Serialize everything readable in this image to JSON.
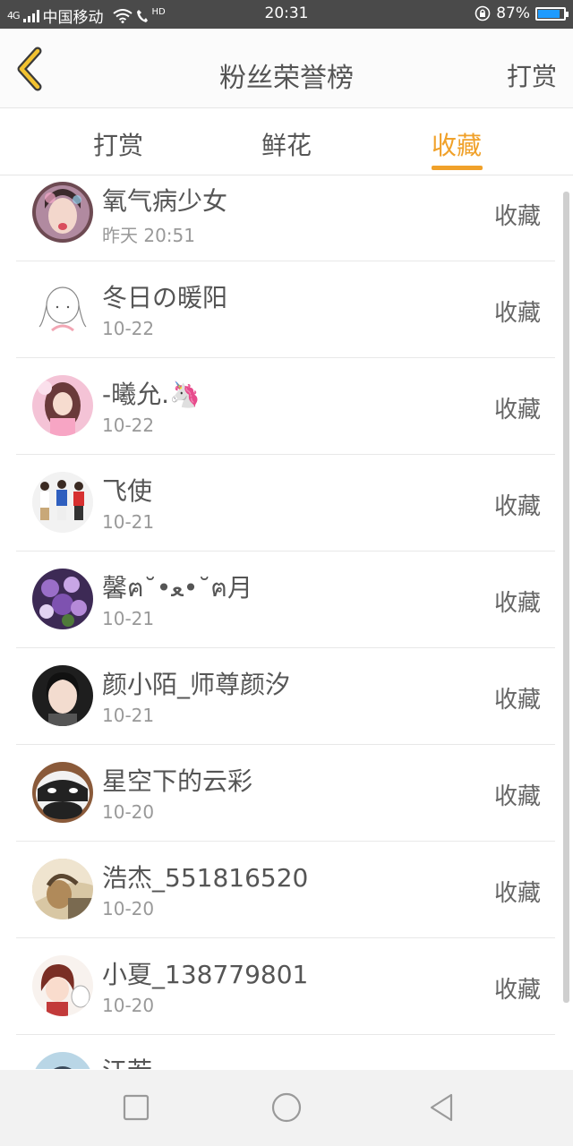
{
  "status_bar": {
    "network": "4G",
    "carrier": "中国移动",
    "hd": "HD",
    "time": "20:31",
    "battery": "87%",
    "battery_level": 0.87
  },
  "header": {
    "title": "粉丝荣誉榜",
    "action": "打赏",
    "accent": "#f0a12a"
  },
  "tabs": [
    {
      "label": "打赏",
      "active": false
    },
    {
      "label": "鲜花",
      "active": false
    },
    {
      "label": "收藏",
      "active": true
    }
  ],
  "fans": [
    {
      "name": "氧气病少女",
      "date": "昨天 20:51",
      "action": "收藏"
    },
    {
      "name": "冬日の暖阳",
      "date": "10-22",
      "action": "收藏"
    },
    {
      "name": "-曦允.🦄",
      "date": "10-22",
      "action": "收藏"
    },
    {
      "name": "飞使",
      "date": "10-21",
      "action": "收藏"
    },
    {
      "name": "馨ฅ˘•ﻌ•˘ฅ月",
      "date": "10-21",
      "action": "收藏"
    },
    {
      "name": "颜小陌_师尊颜汐",
      "date": "10-21",
      "action": "收藏"
    },
    {
      "name": "星空下的云彩",
      "date": "10-20",
      "action": "收藏"
    },
    {
      "name": "浩杰_551816520",
      "date": "10-20",
      "action": "收藏"
    },
    {
      "name": "小夏_138779801",
      "date": "10-20",
      "action": "收藏"
    },
    {
      "name": "江若",
      "date": "",
      "action": ""
    }
  ],
  "navbar": {
    "icons": [
      "recent-apps-icon",
      "home-icon",
      "back-icon"
    ]
  }
}
